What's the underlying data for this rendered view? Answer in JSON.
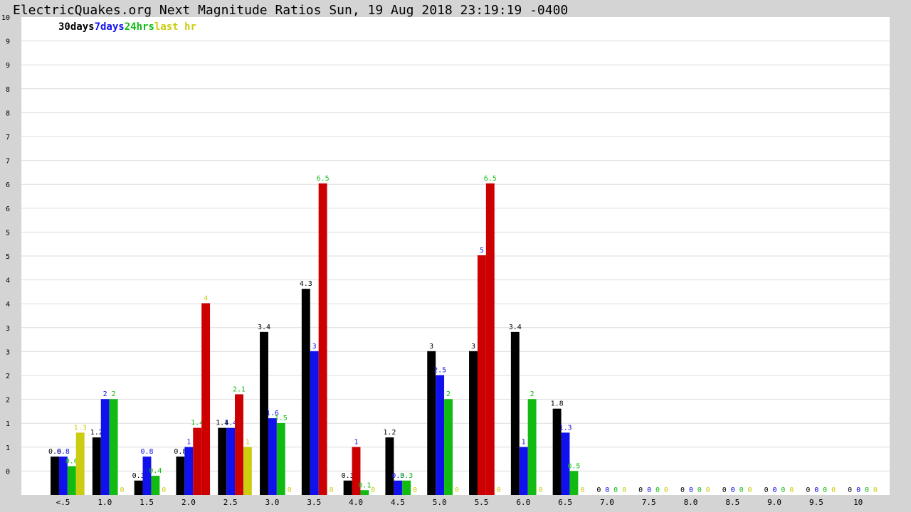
{
  "title": "ElectricQuakes.org Next Magnitude Ratios Sun, 19 Aug 2018 23:19:19 -0400",
  "colors": {
    "30days": "#000000",
    "7days": "#1111ee",
    "24hrs": "#11bb11",
    "last_hr": "#cccc11",
    "highlight": "#cc0000",
    "plot_bg": "#ffffff",
    "page_bg": "#d4d4d4",
    "grid": "#dddddd"
  },
  "chart_data": {
    "type": "bar",
    "categories": [
      "<.5",
      "1.0",
      "1.5",
      "2.0",
      "2.5",
      "3.0",
      "3.5",
      "4.0",
      "4.5",
      "5.0",
      "5.5",
      "6.0",
      "6.5",
      "7.0",
      "7.5",
      "8.0",
      "8.5",
      "9.0",
      "9.5",
      "10"
    ],
    "ylim": [
      0,
      10
    ],
    "y_ticks": [
      "0",
      "1",
      "1",
      "2",
      "2",
      "3",
      "3",
      "4",
      "4",
      "5",
      "5",
      "6",
      "6",
      "7",
      "7",
      "8",
      "8",
      "9",
      "9",
      "10"
    ],
    "legend": [
      "30days",
      "7days",
      "24hrs",
      "last hr"
    ],
    "legend_placement": "top-left",
    "grid": true,
    "series": [
      {
        "name": "30days",
        "values": [
          0.8,
          1.2,
          0.3,
          0.8,
          1.4,
          3.4,
          4.3,
          0.3,
          1.2,
          3,
          3,
          3.4,
          1.8,
          0,
          0,
          0,
          0,
          0,
          0,
          0
        ]
      },
      {
        "name": "7days",
        "values": [
          0.8,
          2,
          0.8,
          1,
          1.4,
          1.6,
          3,
          1,
          0.3,
          2.5,
          5,
          1,
          1.3,
          0,
          0,
          0,
          0,
          0,
          0,
          0
        ]
      },
      {
        "name": "24hrs",
        "values": [
          0.6,
          2,
          0.4,
          1.4,
          2.1,
          1.5,
          6.5,
          0.1,
          0.3,
          2,
          6.5,
          2,
          0.5,
          0,
          0,
          0,
          0,
          0,
          0,
          0
        ]
      },
      {
        "name": "last hr",
        "values": [
          1.3,
          0,
          0,
          4,
          1,
          0,
          0,
          0,
          0,
          0,
          0,
          0,
          0,
          0,
          0,
          0,
          0,
          0,
          0,
          0
        ]
      }
    ],
    "highlighted_bars": [
      {
        "category": "2.0",
        "series": "24hrs"
      },
      {
        "category": "2.0",
        "series": "last hr"
      },
      {
        "category": "2.5",
        "series": "24hrs"
      },
      {
        "category": "3.5",
        "series": "24hrs"
      },
      {
        "category": "4.0",
        "series": "7days"
      },
      {
        "category": "5.5",
        "series": "7days"
      },
      {
        "category": "5.5",
        "series": "24hrs"
      }
    ]
  }
}
